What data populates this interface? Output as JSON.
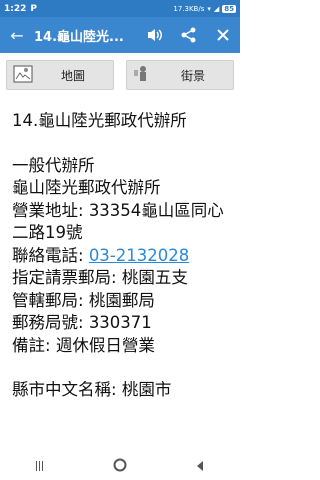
{
  "status": {
    "time": "1:22",
    "net": "17.3KB/s",
    "battery": "85"
  },
  "appbar": {
    "title": "14.龜山陸光..."
  },
  "toolbar": {
    "map_label": "地圖",
    "street_label": "街景"
  },
  "content": {
    "heading": "14.龜山陸光郵政代辦所",
    "type": "一般代辦所",
    "name": "龜山陸光郵政代辦所",
    "address_label": "營業地址: ",
    "address_value": "33354龜山區同心二路19號",
    "phone_label": "聯絡電話: ",
    "phone_value": "03-2132028",
    "office_label": "指定請票郵局: ",
    "office_value": "桃園五支",
    "admin_label": "管轄郵局: ",
    "admin_value": "桃園郵局",
    "code_label": "郵務局號: ",
    "code_value": "330371",
    "note_label": "備註: ",
    "note_value": "週休假日營業",
    "county_label": "縣市中文名稱: ",
    "county_value": "桃園市"
  },
  "icons": [
    "back-arrow-icon",
    "volume-icon",
    "share-icon",
    "close-icon",
    "map-icon",
    "street-view-icon"
  ]
}
